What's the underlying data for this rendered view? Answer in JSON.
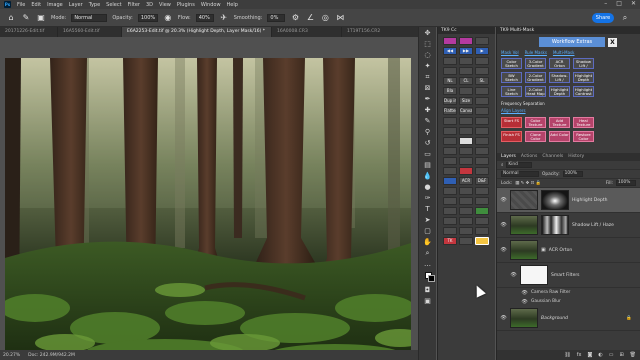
{
  "menubar": {
    "app_logo": "Ps",
    "items": [
      "File",
      "Edit",
      "Image",
      "Layer",
      "Type",
      "Select",
      "Filter",
      "3D",
      "View",
      "Plugins",
      "Window",
      "Help"
    ],
    "window_controls": [
      "–",
      "□",
      "✕"
    ]
  },
  "options": {
    "mode_label": "Mode:",
    "mode_value": "Normal",
    "opacity_label": "Opacity:",
    "opacity_value": "100%",
    "flow_label": "Flow:",
    "flow_value": "40%",
    "smoothing_label": "Smoothing:",
    "smoothing_value": "0%",
    "share_label": "Share"
  },
  "tabs": [
    {
      "label": "20171226-Edit.tif",
      "active": false
    },
    {
      "label": "16A5560-Edit.tif",
      "active": false
    },
    {
      "label": "E6A2253-Edit.tif @ 20.3% (Highlight Depth, Layer Mask/16) *",
      "active": true
    },
    {
      "label": "16A0008.CR3",
      "active": false
    },
    {
      "label": "1T19T156.CR2",
      "active": false
    }
  ],
  "status": {
    "zoom": "20.27%",
    "doc_size": "Doc: 242.9M/942.2M"
  },
  "toolbar_icons": [
    "move-icon",
    "marquee-icon",
    "lasso-icon",
    "quick-select-icon",
    "crop-icon",
    "frame-icon",
    "eyedropper-icon",
    "healing-icon",
    "brush-icon",
    "clone-stamp-icon",
    "history-brush-icon",
    "eraser-icon",
    "gradient-icon",
    "blur-icon",
    "dodge-icon",
    "pen-icon",
    "type-icon",
    "path-select-icon",
    "rectangle-icon",
    "hand-icon",
    "zoom-icon",
    "more-icon"
  ],
  "tk9cc": {
    "title": "TK9 Cc",
    "buttons": [
      {
        "label": "",
        "color": "magenta"
      },
      {
        "label": "",
        "color": "magenta"
      },
      {
        "label": "",
        "color": "dark"
      },
      {
        "label": "◀◀",
        "color": "blue"
      },
      {
        "label": "▶▶",
        "color": "blue"
      },
      {
        "label": "▶",
        "color": "blue"
      },
      {
        "label": "",
        "color": "dark"
      },
      {
        "label": "",
        "color": "dark"
      },
      {
        "label": "",
        "color": "dark"
      },
      {
        "label": "",
        "color": "dark"
      },
      {
        "label": "",
        "color": "dark"
      },
      {
        "label": "",
        "color": "dark"
      },
      {
        "label": "NL",
        "color": "dark"
      },
      {
        "label": "CL",
        "color": "dark"
      },
      {
        "label": "SL",
        "color": "dark"
      },
      {
        "label": "Bla",
        "color": "dark"
      },
      {
        "label": "",
        "color": "dark"
      },
      {
        "label": "",
        "color": "dark"
      },
      {
        "label": "Dup img",
        "color": "dark"
      },
      {
        "label": "Size",
        "color": "dark"
      },
      {
        "label": "",
        "color": "dark"
      },
      {
        "label": "Flatten",
        "color": "dark"
      },
      {
        "label": "Canvas",
        "color": "dark"
      },
      {
        "label": "",
        "color": "dark"
      },
      {
        "label": "",
        "color": "dark"
      },
      {
        "label": "",
        "color": "dark"
      },
      {
        "label": "",
        "color": "dark"
      },
      {
        "label": "",
        "color": "dark"
      },
      {
        "label": "",
        "color": "dark"
      },
      {
        "label": "",
        "color": "dark"
      },
      {
        "label": "",
        "color": "dark"
      },
      {
        "label": "",
        "color": "white"
      },
      {
        "label": "",
        "color": "dark"
      },
      {
        "label": "",
        "color": "dark"
      },
      {
        "label": "",
        "color": "dark"
      },
      {
        "label": "",
        "color": "dark"
      },
      {
        "label": "",
        "color": "dark"
      },
      {
        "label": "",
        "color": "dark"
      },
      {
        "label": "",
        "color": "dark"
      },
      {
        "label": "",
        "color": "dark"
      },
      {
        "label": "",
        "color": "red"
      },
      {
        "label": "",
        "color": "dark"
      },
      {
        "label": "",
        "color": "blue"
      },
      {
        "label": "ACR",
        "color": "dark"
      },
      {
        "label": "D&F",
        "color": "dark"
      },
      {
        "label": "",
        "color": "dark"
      },
      {
        "label": "",
        "color": "dark"
      },
      {
        "label": "",
        "color": "dark"
      },
      {
        "label": "",
        "color": "dark"
      },
      {
        "label": "",
        "color": "dark"
      },
      {
        "label": "",
        "color": "dark"
      },
      {
        "label": "",
        "color": "dark"
      },
      {
        "label": "",
        "color": "dark"
      },
      {
        "label": "",
        "color": "green"
      },
      {
        "label": "",
        "color": "dark"
      },
      {
        "label": "",
        "color": "dark"
      },
      {
        "label": "",
        "color": "dark"
      },
      {
        "label": "",
        "color": "dark"
      },
      {
        "label": "",
        "color": "dark"
      },
      {
        "label": "",
        "color": "dark"
      },
      {
        "label": "TK",
        "color": "red"
      },
      {
        "label": "",
        "color": "dark"
      },
      {
        "label": "",
        "color": "highlight"
      }
    ]
  },
  "tk9mm": {
    "title": "TK9 Multi-Mask",
    "extras_label": "Workflow Extras",
    "close_label": "X",
    "links": [
      "Mask Vol",
      "Rule Masks",
      "Multi-Mask"
    ],
    "grid1": [
      {
        "label": "Color Sketch",
        "style": "dark"
      },
      {
        "label": "3-Color Gradient",
        "style": "dark"
      },
      {
        "label": "ACR Orton",
        "style": "dark"
      },
      {
        "label": "Shadow Lift / Haze",
        "style": "dark"
      },
      {
        "label": "BW Sketch",
        "style": "dark"
      },
      {
        "label": "2-Color Gradient",
        "style": "dark"
      },
      {
        "label": "Shadow-Lift / Haze",
        "style": "dark"
      },
      {
        "label": "Highlight Depth",
        "style": "dark"
      },
      {
        "label": "Line Sketch",
        "style": "dark"
      },
      {
        "label": "2-Color Heat Map",
        "style": "dark"
      },
      {
        "label": "Highlight Depth",
        "style": "dark"
      },
      {
        "label": "Highlight Contrast",
        "style": "dark"
      }
    ],
    "freq_sep_label": "Frequency Separation",
    "freq_sep_link": "Align Layers",
    "grid2": [
      {
        "label": "Start FS",
        "style": "red"
      },
      {
        "label": "Color Texture",
        "style": "pinkbg"
      },
      {
        "label": "Add Texture",
        "style": "pinkbg"
      },
      {
        "label": "Heal Texture",
        "style": "pinkbg"
      },
      {
        "label": "Finish FS",
        "style": "red"
      },
      {
        "label": "Clone Color",
        "style": "pinkbg"
      },
      {
        "label": "Add Color",
        "style": "pinkbg"
      },
      {
        "label": "Restore Color",
        "style": "pinkbg"
      }
    ],
    "top_right_button": "Restore texture"
  },
  "layers": {
    "tabs": [
      "Layers",
      "Actions",
      "Channels",
      "History"
    ],
    "kind_label": "Kind",
    "blend_mode": "Normal",
    "opacity_label": "Opacity:",
    "opacity_value": "100%",
    "lock_label": "Lock:",
    "fill_label": "Fill:",
    "fill_value": "100%",
    "list": [
      {
        "name": "Highlight Depth",
        "thumb": "blank",
        "mask": "mask-dark",
        "selected": true
      },
      {
        "name": "Shadow Lift / Haze",
        "thumb": "forest",
        "mask": "mask-streak",
        "selected": false
      },
      {
        "name": "ACR Orton",
        "thumb": "forest",
        "mask": "",
        "selected": false
      },
      {
        "name": "Smart Filters",
        "thumb": "white",
        "mask": "",
        "selected": false
      },
      {
        "name": "Background",
        "thumb": "forest",
        "mask": "",
        "selected": false
      }
    ],
    "filters": [
      "Camera Raw Filter",
      "Gaussian Blur"
    ]
  }
}
